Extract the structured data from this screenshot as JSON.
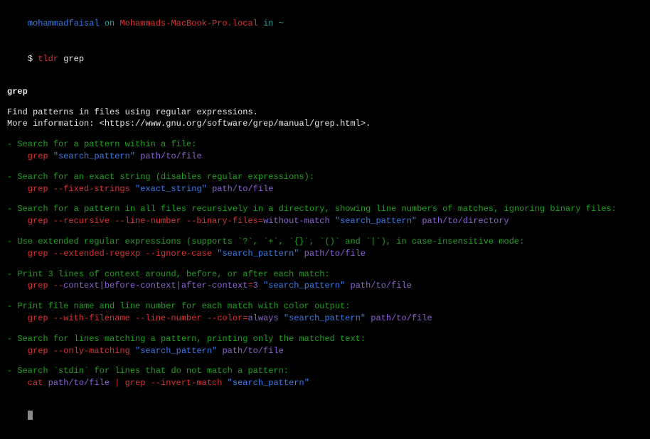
{
  "prompt": {
    "user": "mohammadfaisal",
    "on": " on ",
    "host": "Mohammads-MacBook-Pro.local",
    "in_": " in ",
    "path": "~",
    "ps1": "$ ",
    "cmd_tool": "tldr",
    "cmd_arg": "grep"
  },
  "header": {
    "title": "grep",
    "desc": "Find patterns in files using regular expressions.",
    "more": "More information: <https://www.gnu.org/software/grep/manual/grep.html>."
  },
  "items": [
    {
      "desc": "Search for a pattern within a file:",
      "segs": [
        {
          "t": "grep ",
          "c": "red"
        },
        {
          "t": "\"search_pattern\"",
          "c": "blue"
        },
        {
          "t": " ",
          "c": "red"
        },
        {
          "t": "path/to/file",
          "c": "purple"
        }
      ]
    },
    {
      "desc": "Search for an exact string (disables regular expressions):",
      "segs": [
        {
          "t": "grep --fixed-strings ",
          "c": "red"
        },
        {
          "t": "\"exact_string\"",
          "c": "blue"
        },
        {
          "t": " ",
          "c": "red"
        },
        {
          "t": "path/to/file",
          "c": "purple"
        }
      ]
    },
    {
      "desc": "Search for a pattern in all files recursively in a directory, showing line numbers of matches, ignoring binary files:",
      "segs": [
        {
          "t": "grep --recursive --line-number --binary-files=",
          "c": "red"
        },
        {
          "t": "without-match",
          "c": "purple"
        },
        {
          "t": " ",
          "c": "red"
        },
        {
          "t": "\"search_pattern\"",
          "c": "blue"
        },
        {
          "t": " ",
          "c": "red"
        },
        {
          "t": "path/to/directory",
          "c": "purple"
        }
      ]
    },
    {
      "desc": "Use extended regular expressions (supports `?`, `+`, `{}`, `()` and `|`), in case-insensitive mode:",
      "segs": [
        {
          "t": "grep --extended-regexp --ignore-case ",
          "c": "red"
        },
        {
          "t": "\"search_pattern\"",
          "c": "blue"
        },
        {
          "t": " ",
          "c": "red"
        },
        {
          "t": "path/to/file",
          "c": "purple"
        }
      ]
    },
    {
      "desc": "Print 3 lines of context around, before, or after each match:",
      "segs": [
        {
          "t": "grep --",
          "c": "red"
        },
        {
          "t": "context|before-context|after-context",
          "c": "purple"
        },
        {
          "t": "=",
          "c": "red"
        },
        {
          "t": "3",
          "c": "purple"
        },
        {
          "t": " ",
          "c": "red"
        },
        {
          "t": "\"search_pattern\"",
          "c": "blue"
        },
        {
          "t": " ",
          "c": "red"
        },
        {
          "t": "path/to/file",
          "c": "purple"
        }
      ]
    },
    {
      "desc": "Print file name and line number for each match with color output:",
      "segs": [
        {
          "t": "grep --with-filename --line-number --color=",
          "c": "red"
        },
        {
          "t": "always",
          "c": "purple"
        },
        {
          "t": " ",
          "c": "red"
        },
        {
          "t": "\"search_pattern\"",
          "c": "blue"
        },
        {
          "t": " ",
          "c": "red"
        },
        {
          "t": "path/to/file",
          "c": "purple"
        }
      ]
    },
    {
      "desc": "Search for lines matching a pattern, printing only the matched text:",
      "segs": [
        {
          "t": "grep --only-matching ",
          "c": "red"
        },
        {
          "t": "\"search_pattern\"",
          "c": "blue"
        },
        {
          "t": " ",
          "c": "red"
        },
        {
          "t": "path/to/file",
          "c": "purple"
        }
      ]
    },
    {
      "desc": "Search `stdin` for lines that do not match a pattern:",
      "segs": [
        {
          "t": "cat ",
          "c": "red"
        },
        {
          "t": "path/to/file",
          "c": "purple"
        },
        {
          "t": " | grep --invert-match ",
          "c": "red"
        },
        {
          "t": "\"search_pattern\"",
          "c": "blue"
        }
      ]
    }
  ],
  "dash": "- "
}
